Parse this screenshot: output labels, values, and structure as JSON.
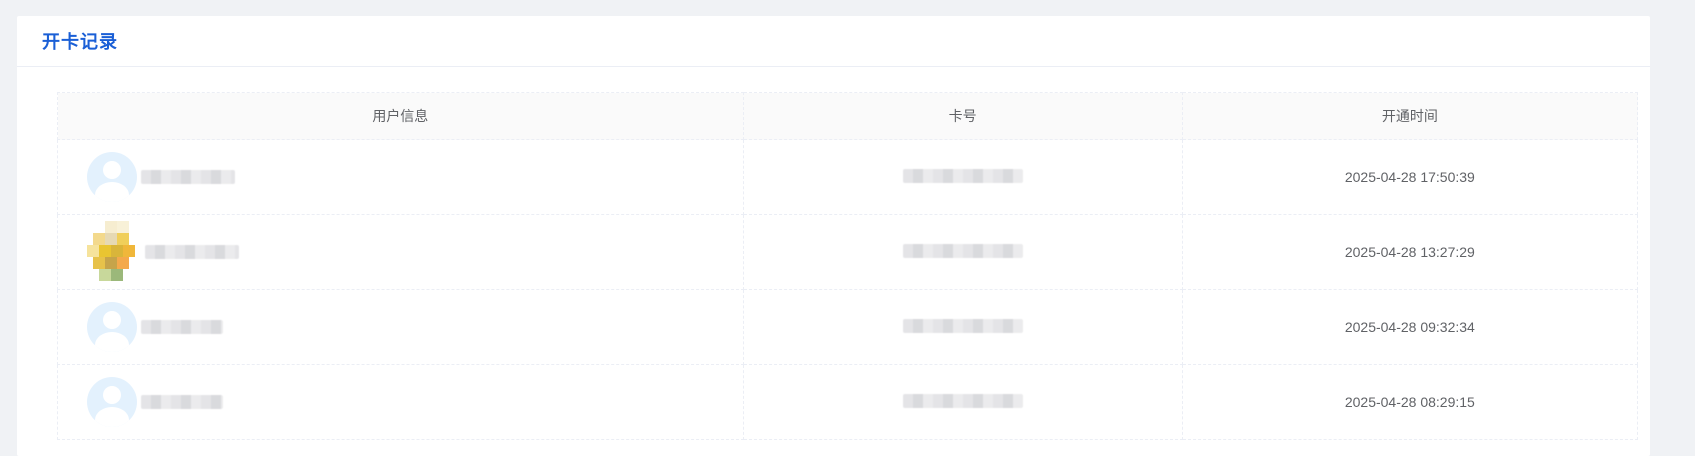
{
  "page": {
    "title": "开卡记录"
  },
  "table": {
    "columns": [
      "用户信息",
      "卡号",
      "开通时间"
    ],
    "rows": [
      {
        "avatar": "default-avatar",
        "user": "",
        "card_no": "",
        "time": "2025-04-28 17:50:39"
      },
      {
        "avatar": "photo-avatar",
        "user": "",
        "card_no": "",
        "time": "2025-04-28 13:27:29"
      },
      {
        "avatar": "default-avatar",
        "user": "",
        "card_no": "",
        "time": "2025-04-28 09:32:34"
      },
      {
        "avatar": "default-avatar",
        "user": "",
        "card_no": "",
        "time": "2025-04-28 08:29:15"
      }
    ]
  },
  "colors": {
    "title": "#1a5fd6",
    "header_bg": "#fafafa",
    "avatar_bg": "#e3f1fd"
  }
}
